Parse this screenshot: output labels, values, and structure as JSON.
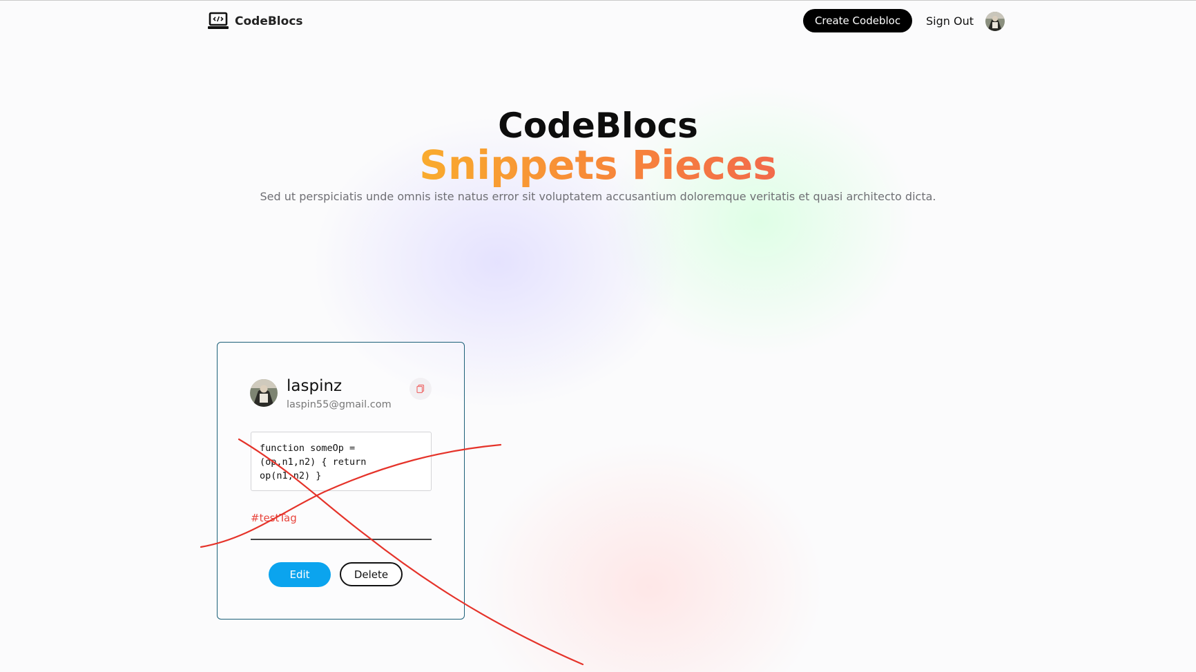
{
  "nav": {
    "brand": "CodeBlocs",
    "create_label": "Create Codebloc",
    "signout_label": "Sign Out"
  },
  "hero": {
    "title": "CodeBlocs",
    "subtitle": "Snippets Pieces",
    "description": "Sed ut perspiciatis unde omnis iste natus error sit voluptatem accusantium doloremque veritatis et quasi architecto dicta."
  },
  "card": {
    "username": "laspinz",
    "email": "laspin55@gmail.com",
    "code": "function someOp =\n(op,n1,n2) { return\nop(n1,n2) }",
    "tag": "#testTag",
    "edit_label": "Edit",
    "delete_label": "Delete"
  },
  "colors": {
    "accent_blue": "#0ba4ee",
    "tag_red": "#e8453d",
    "gradient_start": "#f9ab2d",
    "gradient_end": "#f26a4a",
    "card_border": "#1b5f78",
    "scribble": "#e5332a"
  },
  "icons": {
    "brand": "laptop-code-icon",
    "copy": "copy-icon"
  }
}
